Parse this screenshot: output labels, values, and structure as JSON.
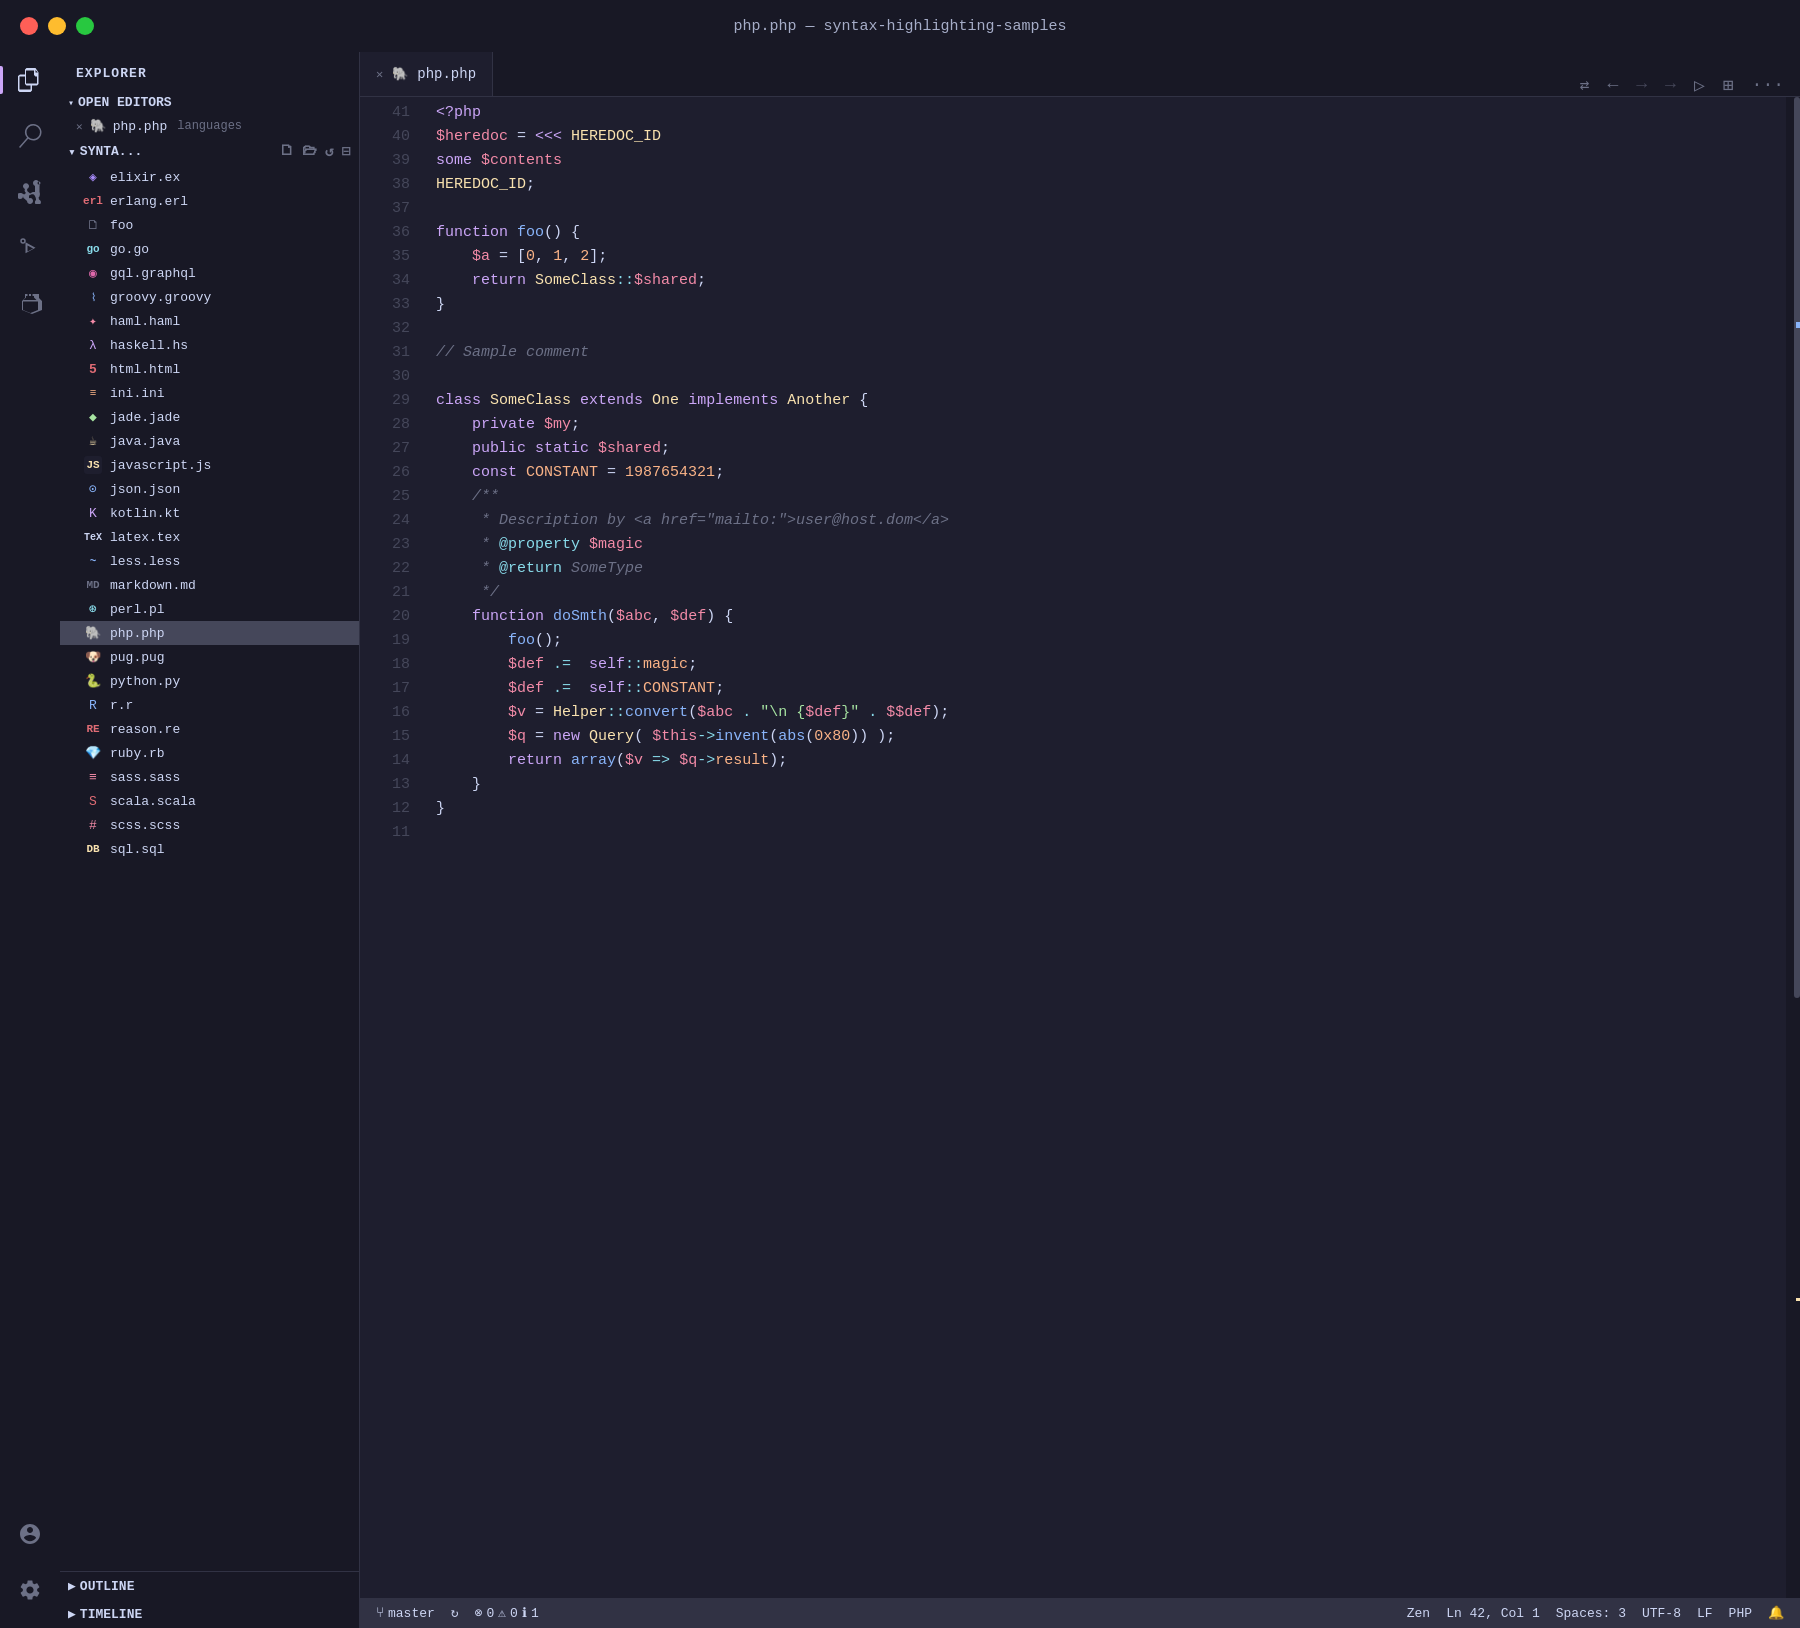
{
  "titlebar": {
    "title": "php.php — syntax-highlighting-samples"
  },
  "activity": {
    "items": [
      "explorer",
      "search",
      "source-control",
      "run",
      "extensions"
    ]
  },
  "sidebar": {
    "title": "EXPLORER",
    "open_editors_label": "OPEN EDITORS",
    "open_files": [
      {
        "name": "php.php",
        "lang": "languages",
        "icon": "php"
      }
    ],
    "syntax_section": "SYNTA...",
    "files": [
      {
        "name": "elixir.ex",
        "icon": "elixir"
      },
      {
        "name": "erlang.erl",
        "icon": "erlang"
      },
      {
        "name": "foo",
        "icon": "default"
      },
      {
        "name": "go.go",
        "icon": "go"
      },
      {
        "name": "gql.graphql",
        "icon": "graphql"
      },
      {
        "name": "groovy.groovy",
        "icon": "groovy"
      },
      {
        "name": "haml.haml",
        "icon": "haml"
      },
      {
        "name": "haskell.hs",
        "icon": "haskell"
      },
      {
        "name": "html.html",
        "icon": "html"
      },
      {
        "name": "ini.ini",
        "icon": "ini"
      },
      {
        "name": "jade.jade",
        "icon": "jade"
      },
      {
        "name": "java.java",
        "icon": "java"
      },
      {
        "name": "javascript.js",
        "icon": "js"
      },
      {
        "name": "json.json",
        "icon": "json"
      },
      {
        "name": "kotlin.kt",
        "icon": "kotlin"
      },
      {
        "name": "latex.tex",
        "icon": "latex"
      },
      {
        "name": "less.less",
        "icon": "less"
      },
      {
        "name": "markdown.md",
        "icon": "markdown"
      },
      {
        "name": "perl.pl",
        "icon": "perl"
      },
      {
        "name": "php.php",
        "icon": "php",
        "active": true
      },
      {
        "name": "pug.pug",
        "icon": "pug"
      },
      {
        "name": "python.py",
        "icon": "python"
      },
      {
        "name": "r.r",
        "icon": "r"
      },
      {
        "name": "reason.re",
        "icon": "reason"
      },
      {
        "name": "ruby.rb",
        "icon": "ruby"
      },
      {
        "name": "sass.sass",
        "icon": "sass"
      },
      {
        "name": "scala.scala",
        "icon": "scala"
      },
      {
        "name": "scss.scss",
        "icon": "scss"
      },
      {
        "name": "sql.sql",
        "icon": "sql"
      }
    ],
    "outline_label": "OUTLINE",
    "timeline_label": "TIMELINE"
  },
  "tab": {
    "filename": "php.php",
    "icon": "php"
  },
  "toolbar": {
    "icons": [
      "split",
      "back",
      "forward-2",
      "forward",
      "play",
      "split-view",
      "more"
    ]
  },
  "code": {
    "lines": [
      {
        "num": 41,
        "content": "php_open"
      },
      {
        "num": 40,
        "content": "heredoc_assign"
      },
      {
        "num": 39,
        "content": "heredoc_content"
      },
      {
        "num": 38,
        "content": "heredoc_end"
      },
      {
        "num": 37,
        "content": "blank"
      },
      {
        "num": 36,
        "content": "func_foo"
      },
      {
        "num": 35,
        "content": "array_assign"
      },
      {
        "num": 34,
        "content": "return_someclass"
      },
      {
        "num": 33,
        "content": "close_brace"
      },
      {
        "num": 32,
        "content": "blank"
      },
      {
        "num": 31,
        "content": "comment_sample"
      },
      {
        "num": 30,
        "content": "blank"
      },
      {
        "num": 29,
        "content": "class_decl"
      },
      {
        "num": 28,
        "content": "private_my"
      },
      {
        "num": 27,
        "content": "public_static"
      },
      {
        "num": 26,
        "content": "const_decl"
      },
      {
        "num": 25,
        "content": "doc_open"
      },
      {
        "num": 24,
        "content": "doc_desc"
      },
      {
        "num": 23,
        "content": "doc_property"
      },
      {
        "num": 22,
        "content": "doc_return"
      },
      {
        "num": 21,
        "content": "doc_close"
      },
      {
        "num": 20,
        "content": "func_dosmth"
      },
      {
        "num": 19,
        "content": "call_foo"
      },
      {
        "num": 18,
        "content": "def_magic"
      },
      {
        "num": 17,
        "content": "def_constant"
      },
      {
        "num": 16,
        "content": "v_helper"
      },
      {
        "num": 15,
        "content": "q_query"
      },
      {
        "num": 14,
        "content": "return_array"
      },
      {
        "num": 13,
        "content": "close_brace"
      },
      {
        "num": 12,
        "content": "close_brace"
      },
      {
        "num": 11,
        "content": "blank"
      }
    ]
  },
  "status": {
    "branch": "master",
    "errors": "0",
    "warnings": "0",
    "infos": "1",
    "zen": "Zen",
    "position": "Ln 42, Col 1",
    "spaces": "Spaces: 3",
    "encoding": "UTF-8",
    "eol": "LF",
    "language": "PHP"
  }
}
